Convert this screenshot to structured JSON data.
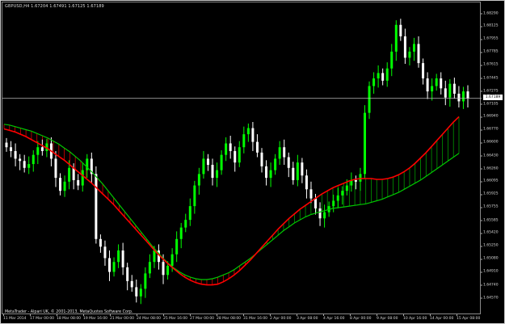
{
  "chart_info": {
    "symbol": "GBPUSD,H4",
    "open": "1.67204",
    "high": "1.67491",
    "low": "1.67125",
    "close": "1.67189",
    "copyright": "MetaTrader - Alpari UK, © 2001-2013, MetaQuotes Software Corp."
  },
  "price_axis": {
    "ticks": [
      "1.68290",
      "1.68125",
      "1.67955",
      "1.67785",
      "1.67615",
      "1.67445",
      "1.67275",
      "1.67105",
      "1.66940",
      "1.66770",
      "1.66600",
      "1.66430",
      "1.66260",
      "1.66095",
      "1.65925",
      "1.65755",
      "1.65585",
      "1.65420",
      "1.65250",
      "1.65080",
      "1.64910",
      "1.64740",
      "1.64570"
    ],
    "current_price": "1.67189"
  },
  "time_axis": {
    "labels": [
      "11 Mar 2014",
      "17 Mar 00:00",
      "18 Mar 08:00",
      "19 Mar 16:00",
      "21 Mar 00:00",
      "24 Mar 08:00",
      "25 Mar 16:00",
      "27 Mar 00:00",
      "28 Mar 08:00",
      "31 Mar 16:00",
      "2 Apr 00:00",
      "3 Apr 08:00",
      "4 Apr 16:00",
      "8 Apr 00:00",
      "9 Apr 08:00",
      "10 Apr 16:00",
      "14 Apr 00:00",
      "15 Apr 08:00"
    ]
  },
  "colors": {
    "background": "#000000",
    "bull_candle": "#00ff00",
    "bear_candle": "#ffffff",
    "fast_line": "#ff0000",
    "slow_line": "#00c800",
    "fill_down": "#ff0000",
    "fill_up": "#00b400",
    "price_line": "#c0c0c0"
  },
  "chart_data": {
    "type": "candlestick",
    "symbol": "GBPUSD",
    "timeframe": "H4",
    "ylim": [
      1.6445,
      1.6838
    ],
    "closes": [
      1.6655,
      1.665,
      1.664,
      1.6637,
      1.6628,
      1.6633,
      1.6645,
      1.6655,
      1.665,
      1.666,
      1.664,
      1.6615,
      1.6598,
      1.661,
      1.6628,
      1.6612,
      1.6605,
      1.6625,
      1.664,
      1.662,
      1.6535,
      1.6525,
      1.651,
      1.6492,
      1.6505,
      1.652,
      1.6498,
      1.648,
      1.6472,
      1.646,
      1.647,
      1.649,
      1.6505,
      1.652,
      1.6505,
      1.6488,
      1.65,
      1.6515,
      1.6535,
      1.655,
      1.656,
      1.6578,
      1.6605,
      1.662,
      1.664,
      1.6632,
      1.6615,
      1.6625,
      1.6645,
      1.666,
      1.665,
      1.6635,
      1.6655,
      1.6672,
      1.668,
      1.6662,
      1.6648,
      1.663,
      1.6615,
      1.6625,
      1.664,
      1.6655,
      1.6642,
      1.6628,
      1.6612,
      1.6635,
      1.6618,
      1.66,
      1.6588,
      1.6575,
      1.6562,
      1.657,
      1.6578,
      1.6585,
      1.6592,
      1.6598,
      1.6605,
      1.6612,
      1.661,
      1.662,
      1.67,
      1.6735,
      1.6745,
      1.6752,
      1.6742,
      1.6758,
      1.678,
      1.6815,
      1.68,
      1.6772,
      1.678,
      1.679,
      1.6765,
      1.6745,
      1.6728,
      1.6735,
      1.6745,
      1.6732,
      1.672,
      1.6738,
      1.6725,
      1.6715,
      1.6728,
      1.6719
    ],
    "fast_ma": [
      1.6679,
      1.6677,
      1.6675,
      1.6672,
      1.6669,
      1.6665,
      1.6661,
      1.6657,
      1.6653,
      1.6648,
      1.6643,
      1.6638,
      1.6632,
      1.6626,
      1.662,
      1.6614,
      1.6608,
      1.6601,
      1.6594,
      1.6587,
      1.658,
      1.6572,
      1.6564,
      1.6556,
      1.6548,
      1.654,
      1.6532,
      1.6524,
      1.6516,
      1.6509,
      1.6502,
      1.6496,
      1.649,
      1.6485,
      1.6481,
      1.6478,
      1.6476,
      1.6475,
      1.6475,
      1.6476,
      1.6479,
      1.6483,
      1.6488,
      1.6494,
      1.6501,
      1.6508,
      1.6516,
      1.6524,
      1.6532,
      1.654,
      1.6548,
      1.6555,
      1.6562,
      1.6568,
      1.6574,
      1.6579,
      1.6584,
      1.6589,
      1.6594,
      1.6598,
      1.6602,
      1.6605,
      1.6608,
      1.6611,
      1.6613,
      1.6614,
      1.6614,
      1.6614,
      1.6613,
      1.6613,
      1.6614,
      1.6616,
      1.6619,
      1.6623,
      1.6628,
      1.6634,
      1.6641,
      1.6648,
      1.6656,
      1.6664,
      1.6672,
      1.668,
      1.6688,
      1.6695
    ],
    "slow_ma": [
      1.6685,
      1.6684,
      1.6682,
      1.668,
      1.6678,
      1.6676,
      1.6673,
      1.667,
      1.6667,
      1.6663,
      1.6659,
      1.6654,
      1.6649,
      1.6643,
      1.6637,
      1.663,
      1.6623,
      1.6615,
      1.6607,
      1.6598,
      1.6589,
      1.658,
      1.6571,
      1.6562,
      1.6553,
      1.6544,
      1.6535,
      1.6526,
      1.6518,
      1.651,
      1.6503,
      1.6497,
      1.6492,
      1.6488,
      1.6485,
      1.6483,
      1.6482,
      1.6482,
      1.6483,
      1.6485,
      1.6488,
      1.6491,
      1.6495,
      1.65,
      1.6505,
      1.651,
      1.6516,
      1.6522,
      1.6528,
      1.6534,
      1.654,
      1.6546,
      1.6551,
      1.6556,
      1.656,
      1.6564,
      1.6567,
      1.6569,
      1.6571,
      1.6573,
      1.6575,
      1.6576,
      1.6577,
      1.6578,
      1.6579,
      1.658,
      1.6581,
      1.6583,
      1.6585,
      1.6587,
      1.659,
      1.6593,
      1.6596,
      1.66,
      1.6604,
      1.6608,
      1.6612,
      1.6617,
      1.6622,
      1.6627,
      1.6632,
      1.6637,
      1.6642,
      1.6647
    ]
  }
}
